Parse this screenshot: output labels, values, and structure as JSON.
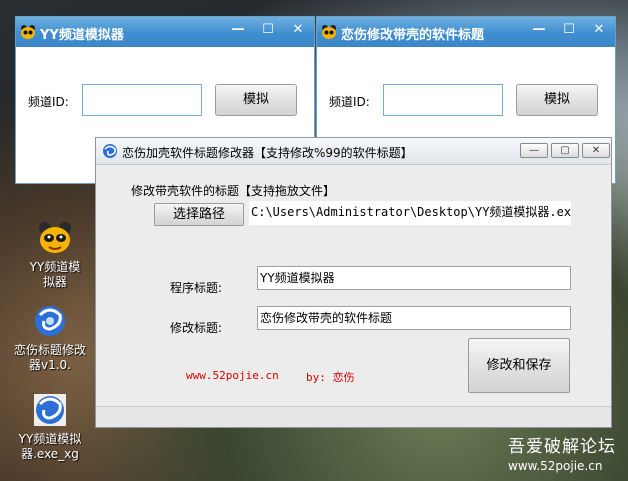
{
  "window1": {
    "title": "YY频道模拟器",
    "label": "频道ID:",
    "input_value": "",
    "button": "模拟",
    "min_glyph": "—",
    "max_glyph": "☐",
    "close_glyph": "✕"
  },
  "window2": {
    "title": "恋伤修改带壳的软件标题",
    "label": "频道ID:",
    "input_value": "",
    "button": "模拟",
    "min_glyph": "—",
    "max_glyph": "☐",
    "close_glyph": "✕"
  },
  "main": {
    "title": "恋伤加壳软件标题修改器【支持修改%99的软件标题】",
    "group_label": "修改带壳软件的标题【支持拖放文件】",
    "choose_path_button": "选择路径",
    "path_value": "C:\\Users\\Administrator\\Desktop\\YY频道模拟器.exe",
    "program_title_label": "程序标题:",
    "program_title_value": "YY频道模拟器",
    "modify_title_label": "修改标题:",
    "modify_title_value": "恋伤修改带壳的软件标题",
    "site_link": "www.52pojie.cn",
    "author": "by: 恋伤",
    "save_button": "修改和保存",
    "controls": {
      "min": "—",
      "restore": "▢",
      "close": "✕"
    }
  },
  "desktop_icons": [
    {
      "label": "YY频道模拟器",
      "icon": "yy-bear-icon"
    },
    {
      "label": "恋伤标题修改器v1.0.",
      "icon": "blue-swirl-icon"
    },
    {
      "label": "YY频道模拟器.exe_xg",
      "icon": "blue-swirl-icon"
    }
  ],
  "watermark": {
    "line1": "吾爱破解论坛",
    "line2": "www.52pojie.cn"
  },
  "colors": {
    "titlebar": "#3f8ed0",
    "link_red": "#d40000",
    "edit_border": "#7aa7d4"
  }
}
